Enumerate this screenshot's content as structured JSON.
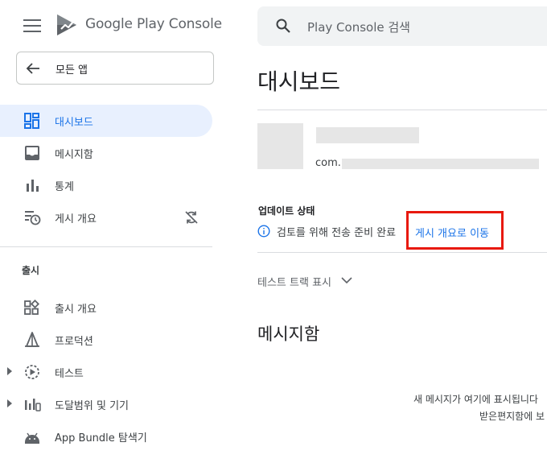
{
  "header": {
    "brand_name": "Google Play Console",
    "search": {
      "placeholder": "Play Console 검색"
    }
  },
  "sidebar": {
    "all_apps_label": "모든 앱",
    "items": [
      {
        "label": "대시보드",
        "icon": "dashboard-icon",
        "active": true
      },
      {
        "label": "메시지함",
        "icon": "inbox-icon"
      },
      {
        "label": "통계",
        "icon": "bar-chart-icon"
      },
      {
        "label": "게시 개요",
        "icon": "publishing-overview-icon",
        "trailing_icon": "sync-disabled-icon"
      }
    ],
    "release_section": {
      "title": "출시",
      "items": [
        {
          "label": "출시 개요",
          "icon": "release-overview-icon"
        },
        {
          "label": "프로덕션",
          "icon": "production-icon"
        },
        {
          "label": "테스트",
          "icon": "testing-icon",
          "expandable": true
        },
        {
          "label": "도달범위 및 기기",
          "icon": "reach-devices-icon",
          "expandable": true
        },
        {
          "label": "App Bundle 탐색기",
          "icon": "android-icon"
        }
      ]
    }
  },
  "main": {
    "title": "대시보드",
    "app": {
      "package_prefix": "com."
    },
    "update_status": {
      "label": "업데이트 상태",
      "text": "검토를 위해 전송 준비 완료",
      "link": "게시 개요로 이동"
    },
    "test_tracks_label": "테스트 트랙 표시",
    "inbox": {
      "title": "메시지함",
      "empty_line1": "새 메시지가 여기에 표시됩니다",
      "empty_line2": "받은편지함에 보"
    }
  },
  "colors": {
    "accent": "#1a73e8",
    "active_bg": "#e8f0fe",
    "highlight_box": "#e8190e"
  }
}
